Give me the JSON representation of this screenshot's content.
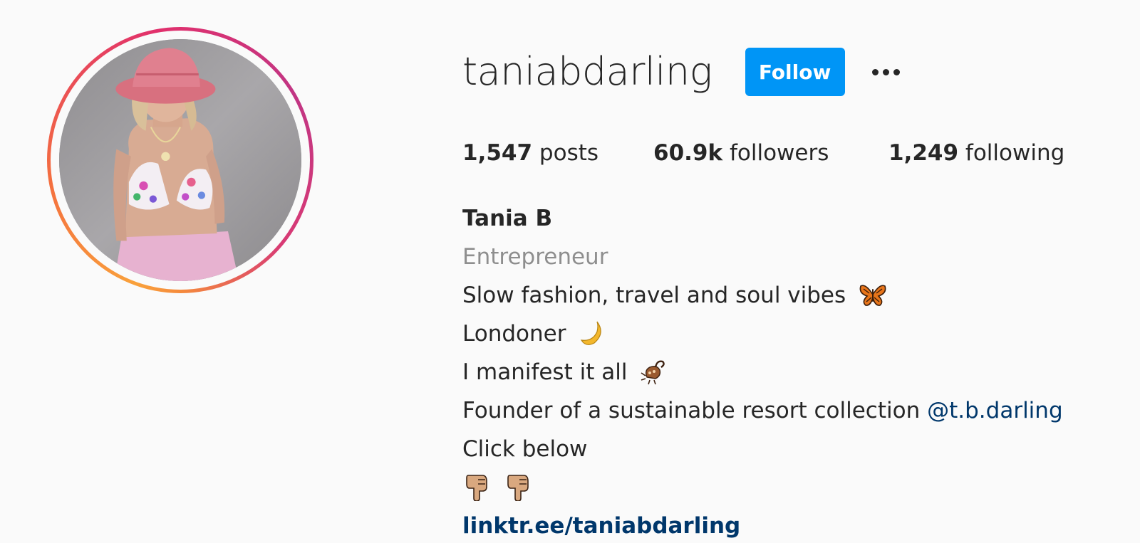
{
  "profile": {
    "username": "taniabdarling",
    "follow_label": "Follow",
    "stats": {
      "posts_count": "1,547",
      "posts_label": "posts",
      "followers_count": "60.9k",
      "followers_label": "followers",
      "following_count": "1,249",
      "following_label": "following"
    },
    "bio": {
      "full_name": "Tania B",
      "category": "Entrepreneur",
      "line1": "Slow fashion, travel and soul vibes",
      "line2": "Londoner",
      "line3": "I manifest it all",
      "line4": "Founder of a sustainable resort collection",
      "mention": "@t.b.darling",
      "line5": "Click below",
      "link": "linktr.ee/taniabdarling"
    },
    "icons": {
      "line1": "butterfly-emoji",
      "line2": "crescent-moon-emoji",
      "line3": "scorpion-emoji",
      "line6": "pointing-down-emoji"
    }
  },
  "colors": {
    "follow_button": "#0095f6",
    "link": "#00376b",
    "category": "#8e8e8e",
    "background": "#fafafa"
  }
}
